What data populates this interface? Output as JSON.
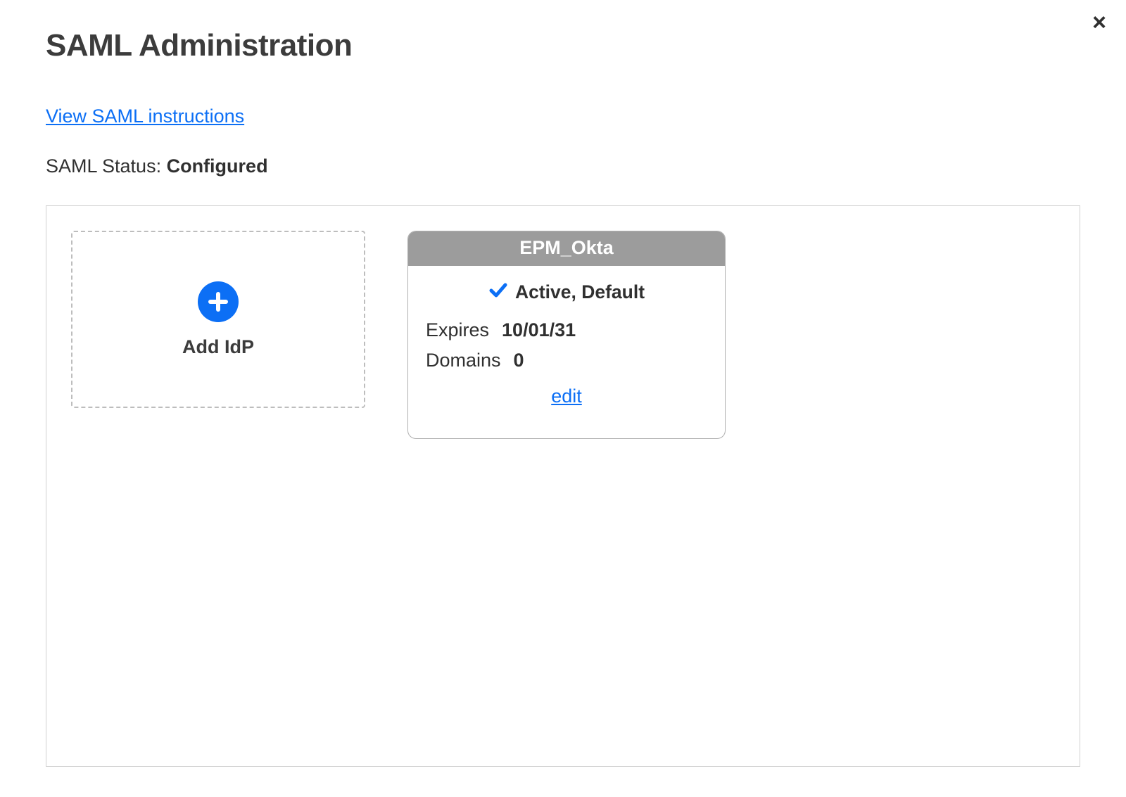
{
  "header": {
    "title": "SAML Administration",
    "close_label": "×"
  },
  "links": {
    "instructions": "View SAML instructions"
  },
  "status": {
    "label": "SAML Status: ",
    "value": "Configured"
  },
  "add_card": {
    "label": "Add IdP"
  },
  "idp": {
    "name": "EPM_Okta",
    "active_text": "Active, Default",
    "expires_label": "Expires",
    "expires_value": "10/01/31",
    "domains_label": "Domains",
    "domains_value": "0",
    "edit_label": "edit"
  },
  "colors": {
    "accent": "#0c6ff5",
    "header_gray": "#9c9c9c",
    "text": "#303030"
  }
}
